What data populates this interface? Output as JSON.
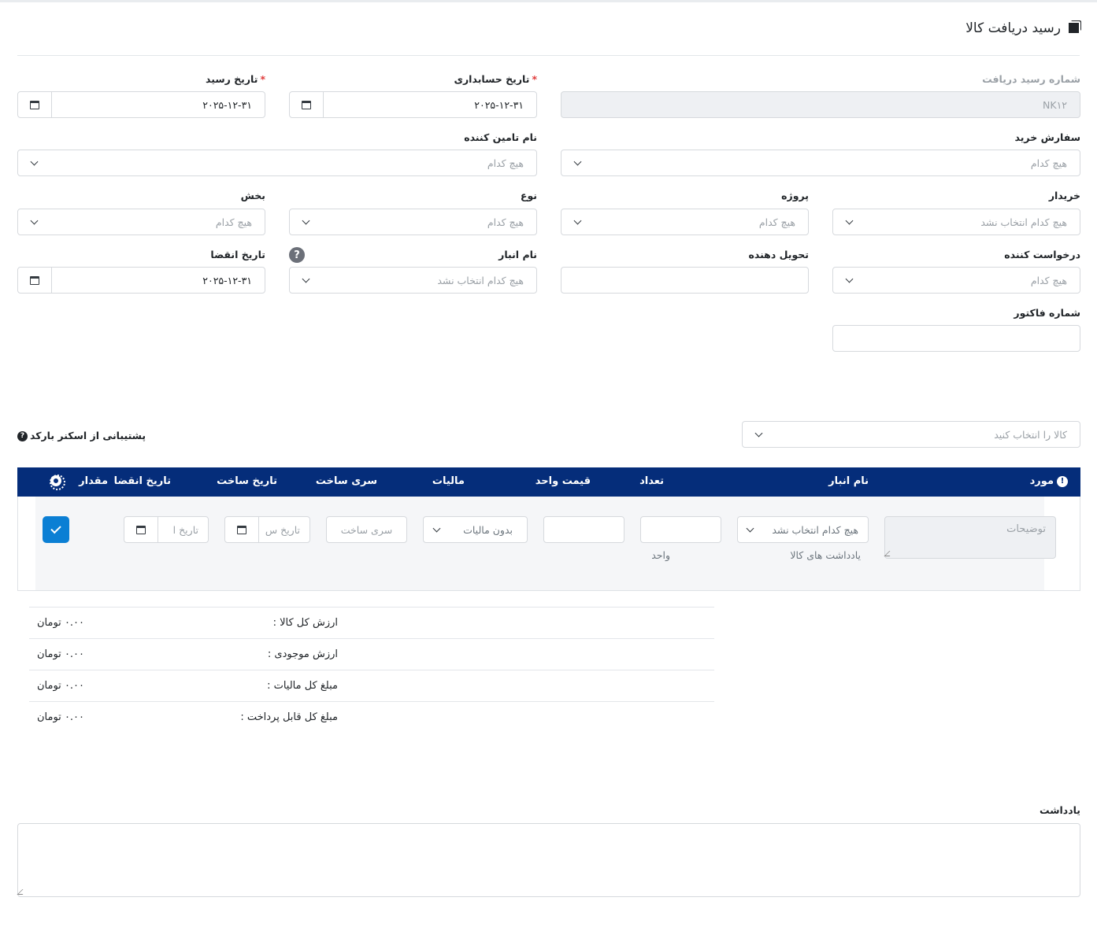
{
  "page": {
    "title": "رسید دریافت کالا"
  },
  "form": {
    "receipt_number": {
      "label": "شماره رسید دریافت",
      "value": "NK۱۲"
    },
    "accounting_date": {
      "label": "تاریخ حسابداری",
      "required": "*",
      "value": "۲۰۲۵-۱۲-۳۱"
    },
    "receipt_date": {
      "label": "تاریخ رسید",
      "required": "*",
      "value": "۲۰۲۵-۱۲-۳۱"
    },
    "purchase_order": {
      "label": "سفارش خرید",
      "placeholder": "هیچ کدام"
    },
    "supplier_name": {
      "label": "نام تامین کننده",
      "placeholder": "هیچ کدام"
    },
    "buyer": {
      "label": "خریدار",
      "placeholder": "هیچ کدام انتخاب نشد"
    },
    "project": {
      "label": "پروژه",
      "placeholder": "هیچ کدام"
    },
    "type": {
      "label": "نوع",
      "placeholder": "هیچ کدام"
    },
    "department": {
      "label": "بخش",
      "placeholder": "هیچ کدام"
    },
    "requester": {
      "label": "درخواست کننده",
      "placeholder": "هیچ کدام"
    },
    "deliverer": {
      "label": "تحویل دهنده",
      "value": ""
    },
    "warehouse": {
      "label": "نام انبار",
      "placeholder": "هیچ کدام انتخاب نشد",
      "help": "?"
    },
    "expiry_date": {
      "label": "تاریخ انقضا",
      "value": "۲۰۲۵-۱۲-۳۱"
    },
    "invoice_number": {
      "label": "شماره فاکتور",
      "value": ""
    }
  },
  "items": {
    "select_product": {
      "placeholder": "کالا را انتخاب کنید"
    },
    "barcode_support": {
      "label": "پشتیبانی از اسکنر بارکد",
      "icon": "?"
    },
    "headers": {
      "item": "مورد",
      "item_icon": "!",
      "warehouse": "نام انبار",
      "quantity": "تعداد",
      "unit_price": "قیمت واحد",
      "tax": "مالیات",
      "batch": "سری ساخت",
      "mfg_date": "تاریخ ساخت",
      "expiry": "تاریخ انقضا",
      "amount": "مقدار"
    },
    "row": {
      "description_placeholder": "توضیحات",
      "warehouse_placeholder": "هیچ کدام انتخاب نشد",
      "warehouse_note": "یادداشت های کالا",
      "quantity_value": "",
      "unit_label": "واحد",
      "unit_price_value": "",
      "tax_placeholder": "بدون مالیات",
      "batch_placeholder": "سری ساخت",
      "mfg_date_placeholder": "تاریخ س",
      "expiry_placeholder": "تاریخ ا"
    }
  },
  "summary": [
    {
      "label": "ارزش کل کالا :",
      "value": "۰.۰۰ تومان"
    },
    {
      "label": "ارزش موجودی :",
      "value": "۰.۰۰ تومان"
    },
    {
      "label": "مبلغ کل مالیات :",
      "value": "۰.۰۰ تومان"
    },
    {
      "label": "مبلغ کل قابل پرداخت :",
      "value": "۰.۰۰ تومان"
    }
  ],
  "note": {
    "label": "یادداشت",
    "value": ""
  }
}
